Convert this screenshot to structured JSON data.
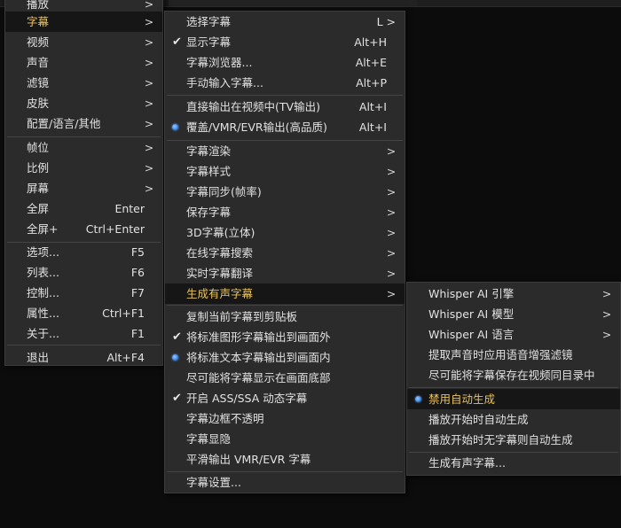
{
  "main_menu": {
    "items": [
      {
        "label": "播放",
        "shortcut": "",
        "submenu": true
      },
      {
        "label": "字幕",
        "shortcut": "",
        "submenu": true,
        "highlighted": true
      },
      {
        "label": "视频",
        "shortcut": "",
        "submenu": true
      },
      {
        "label": "声音",
        "shortcut": "",
        "submenu": true
      },
      {
        "label": "滤镜",
        "shortcut": "",
        "submenu": true
      },
      {
        "label": "皮肤",
        "shortcut": "",
        "submenu": true
      },
      {
        "label": "配置/语言/其他",
        "shortcut": "",
        "submenu": true
      },
      {
        "label": "帧位",
        "shortcut": "",
        "submenu": true
      },
      {
        "label": "比例",
        "shortcut": "",
        "submenu": true
      },
      {
        "label": "屏幕",
        "shortcut": "",
        "submenu": true
      },
      {
        "label": "全屏",
        "shortcut": "Enter",
        "submenu": false
      },
      {
        "label": "全屏+",
        "shortcut": "Ctrl+Enter",
        "submenu": false
      },
      {
        "label": "选项...",
        "shortcut": "F5",
        "submenu": false
      },
      {
        "label": "列表...",
        "shortcut": "F6",
        "submenu": false
      },
      {
        "label": "控制...",
        "shortcut": "F7",
        "submenu": false
      },
      {
        "label": "属性...",
        "shortcut": "Ctrl+F1",
        "submenu": false
      },
      {
        "label": "关于...",
        "shortcut": "F1",
        "submenu": false
      },
      {
        "label": "退出",
        "shortcut": "Alt+F4",
        "submenu": false
      }
    ]
  },
  "subtitle_menu": {
    "items": [
      {
        "label": "选择字幕",
        "shortcut": "L >",
        "mark": ""
      },
      {
        "label": "显示字幕",
        "shortcut": "Alt+H",
        "mark": "check"
      },
      {
        "label": "字幕浏览器...",
        "shortcut": "Alt+E",
        "mark": ""
      },
      {
        "label": "手动输入字幕...",
        "shortcut": "Alt+P",
        "mark": ""
      },
      {
        "label": "直接输出在视频中(TV输出)",
        "shortcut": "Alt+I",
        "mark": ""
      },
      {
        "label": "覆盖/VMR/EVR输出(高品质)",
        "shortcut": "Alt+I",
        "mark": "radio"
      },
      {
        "label": "字幕渲染",
        "submenu": true,
        "mark": ""
      },
      {
        "label": "字幕样式",
        "submenu": true,
        "mark": ""
      },
      {
        "label": "字幕同步(帧率)",
        "submenu": true,
        "mark": ""
      },
      {
        "label": "保存字幕",
        "submenu": true,
        "mark": ""
      },
      {
        "label": "3D字幕(立体)",
        "submenu": true,
        "mark": ""
      },
      {
        "label": "在线字幕搜索",
        "submenu": true,
        "mark": ""
      },
      {
        "label": "实时字幕翻译",
        "submenu": true,
        "mark": ""
      },
      {
        "label": "生成有声字幕",
        "submenu": true,
        "mark": "",
        "highlighted": true
      },
      {
        "label": "复制当前字幕到剪贴板",
        "mark": ""
      },
      {
        "label": "将标准图形字幕输出到画面外",
        "mark": "check"
      },
      {
        "label": "将标准文本字幕输出到画面内",
        "mark": "radio"
      },
      {
        "label": "尽可能将字幕显示在画面底部",
        "mark": ""
      },
      {
        "label": "开启 ASS/SSA 动态字幕",
        "mark": "check"
      },
      {
        "label": "字幕边框不透明",
        "mark": ""
      },
      {
        "label": "字幕显隐",
        "mark": ""
      },
      {
        "label": "平滑输出 VMR/EVR 字幕",
        "mark": ""
      },
      {
        "label": "字幕设置...",
        "mark": ""
      }
    ]
  },
  "audio_subtitle_menu": {
    "items": [
      {
        "label": "Whisper AI 引擎",
        "submenu": true,
        "mark": ""
      },
      {
        "label": "Whisper AI 模型",
        "submenu": true,
        "mark": ""
      },
      {
        "label": "Whisper AI 语言",
        "submenu": true,
        "mark": ""
      },
      {
        "label": "提取声音时应用语音增强滤镜",
        "mark": ""
      },
      {
        "label": "尽可能将字幕保存在视频同目录中",
        "mark": ""
      },
      {
        "label": "禁用自动生成",
        "mark": "radio",
        "highlighted": true
      },
      {
        "label": "播放开始时自动生成",
        "mark": ""
      },
      {
        "label": "播放开始时无字幕则自动生成",
        "mark": ""
      },
      {
        "label": "生成有声字幕...",
        "mark": ""
      }
    ]
  },
  "icons": {
    "submenu_arrow": ">",
    "check": "✔"
  },
  "colors": {
    "highlight_text": "#e8c25b",
    "radio": "#3a86e8",
    "menu_bg": "#2b2b2b"
  }
}
